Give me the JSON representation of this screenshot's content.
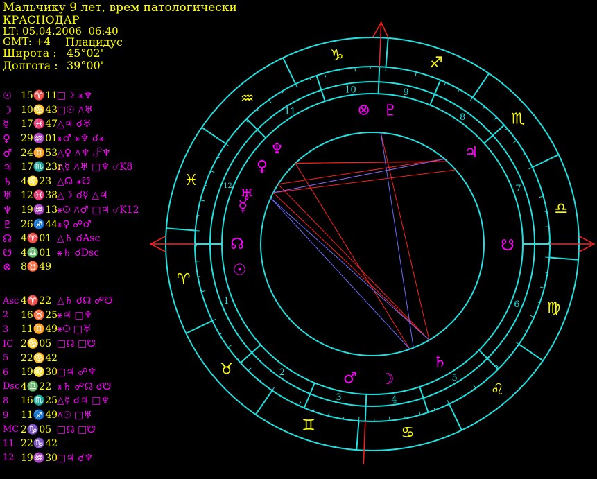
{
  "header": {
    "title": "Мальчику 9 лет, врем патологически",
    "city": "КРАСНОДАР",
    "lt": "LT: 05.04.2006  06:40",
    "gmt": "GMT: +4",
    "system": "Плацидус",
    "lat_label": "Широта :",
    "lat_value": "45°02'",
    "lon_label": "Долгота :",
    "lon_value": "39°00'"
  },
  "planets": [
    {
      "glyph": "☉",
      "pos": "15♈11",
      "aspects": "□☽ ⚹♆"
    },
    {
      "glyph": "☽",
      "pos": "10♋43",
      "aspects": "□☉ ⚻♅"
    },
    {
      "glyph": "☿",
      "pos": "17♓47",
      "aspects": "△♃ ☌♅"
    },
    {
      "glyph": "♀",
      "pos": "29♒01",
      "aspects": "⚹♂ ⚹♆ ☌⚹"
    },
    {
      "glyph": "♂",
      "pos": "24♊53",
      "aspects": "△♀ ⚻♆ ☍♆"
    },
    {
      "glyph": "♃",
      "pos": "17♏23r",
      "aspects": "△☿ ⚻♅ □♆ ☌K8"
    },
    {
      "glyph": "♄",
      "pos": "4♌23",
      "aspects": "△☊ ⚹☋"
    },
    {
      "glyph": "♅",
      "pos": "12♓38",
      "aspects": "△☽ ☌☿ △♃"
    },
    {
      "glyph": "♆",
      "pos": "19♒13",
      "aspects": "⚹☉ ⚻♂ □♃ ☌K12"
    },
    {
      "glyph": "♇",
      "pos": "26♐44",
      "aspects": "⚹♀ ☍♂"
    },
    {
      "glyph": "☊",
      "pos": "4♈01",
      "aspects": "△♄ ☌Asc"
    },
    {
      "glyph": "☋",
      "pos": "4♎01",
      "aspects": "⚹♄ ☌Dsc"
    },
    {
      "glyph": "⊗",
      "pos": "8♉49",
      "aspects": ""
    }
  ],
  "cusps": [
    {
      "label": "Asc",
      "pos": "4♈22",
      "aspects": "△♄ ☌☊ ☍☋"
    },
    {
      "label": "2",
      "pos": "16♉25",
      "aspects": "⚹♃ □♆"
    },
    {
      "label": "3",
      "pos": "11♊49",
      "aspects": "⚹☉ □♅"
    },
    {
      "label": "IC",
      "pos": "2♋05",
      "aspects": "□☊ □☋"
    },
    {
      "label": "5",
      "pos": "22♋42",
      "aspects": ""
    },
    {
      "label": "6",
      "pos": "19♌30",
      "aspects": "□♃ ☍♆"
    },
    {
      "label": "Dsc",
      "pos": "4♎22",
      "aspects": "⚹♄ ☍☊ ☌☋"
    },
    {
      "label": "8",
      "pos": "16♏25",
      "aspects": "△☿ ☌♃ □♆"
    },
    {
      "label": "9",
      "pos": "11♐49",
      "aspects": "⚻☉ □♅"
    },
    {
      "label": "MC",
      "pos": "2♑05",
      "aspects": "□☊ □☋"
    },
    {
      "label": "11",
      "pos": "22♑42",
      "aspects": ""
    },
    {
      "label": "12",
      "pos": "19♒30",
      "aspects": "□♃ ☌♆"
    }
  ],
  "wheel": {
    "signs": [
      {
        "glyph": "♈",
        "deg": 15
      },
      {
        "glyph": "♉",
        "deg": 45
      },
      {
        "glyph": "♊",
        "deg": 75
      },
      {
        "glyph": "♋",
        "deg": 105
      },
      {
        "glyph": "♌",
        "deg": 135
      },
      {
        "glyph": "♍",
        "deg": 165
      },
      {
        "glyph": "♎",
        "deg": 195
      },
      {
        "glyph": "♏",
        "deg": 225
      },
      {
        "glyph": "♐",
        "deg": 255
      },
      {
        "glyph": "♑",
        "deg": 285
      },
      {
        "glyph": "♒",
        "deg": 315
      },
      {
        "glyph": "♓",
        "deg": 345
      }
    ],
    "houses": [
      {
        "num": "1",
        "cusp": 4.37,
        "next": 46.42
      },
      {
        "num": "2",
        "cusp": 46.42,
        "next": 71.82
      },
      {
        "num": "3",
        "cusp": 71.82,
        "next": 92.08
      },
      {
        "num": "4",
        "cusp": 92.08,
        "next": 112.7
      },
      {
        "num": "5",
        "cusp": 112.7,
        "next": 139.5
      },
      {
        "num": "6",
        "cusp": 139.5,
        "next": 184.37
      },
      {
        "num": "7",
        "cusp": 184.37,
        "next": 226.42
      },
      {
        "num": "8",
        "cusp": 226.42,
        "next": 251.82
      },
      {
        "num": "9",
        "cusp": 251.82,
        "next": 272.08
      },
      {
        "num": "10",
        "cusp": 272.08,
        "next": 292.7
      },
      {
        "num": "11",
        "cusp": 292.7,
        "next": 319.5
      },
      {
        "num": "12",
        "cusp": 319.5,
        "next": 364.37
      }
    ],
    "bodies": [
      {
        "glyph": "☉",
        "deg": 15.18,
        "color": "#ff00ff"
      },
      {
        "glyph": "☽",
        "deg": 100.72,
        "color": "#ff00ff"
      },
      {
        "glyph": "☿",
        "deg": 347.78,
        "color": "#ff00ff"
      },
      {
        "glyph": "♀",
        "deg": 329.02,
        "color": "#ff00ff"
      },
      {
        "glyph": "♂",
        "deg": 84.88,
        "color": "#ff00ff"
      },
      {
        "glyph": "♃",
        "deg": 227.38,
        "color": "#ff00ff"
      },
      {
        "glyph": "♄",
        "deg": 124.38,
        "color": "#ff00ff"
      },
      {
        "glyph": "♅",
        "deg": 342.63,
        "color": "#ff00ff"
      },
      {
        "glyph": "♆",
        "deg": 319.22,
        "color": "#ff00ff"
      },
      {
        "glyph": "♇",
        "deg": 266.73,
        "color": "#ff00ff"
      },
      {
        "glyph": "☊",
        "deg": 4.02,
        "color": "#ff00ff"
      },
      {
        "glyph": "☋",
        "deg": 184.02,
        "color": "#ff00ff"
      },
      {
        "glyph": "⊗",
        "deg": 278.0,
        "color": "#ff00ff"
      }
    ],
    "aspect_lines": [
      {
        "a": 337,
        "b": 226,
        "color": "#ff2020"
      },
      {
        "a": 337,
        "b": 234,
        "color": "#ff2020"
      },
      {
        "a": 337,
        "b": 125,
        "color": "#ff2020"
      },
      {
        "a": 318,
        "b": 232,
        "color": "#ff2020"
      },
      {
        "a": 332,
        "b": 234,
        "color": "#ff2020"
      },
      {
        "a": 332,
        "b": 125,
        "color": "#ff2020"
      },
      {
        "a": 270,
        "b": 125,
        "color": "#ff2020"
      },
      {
        "a": 318,
        "b": 114,
        "color": "#ff2020"
      },
      {
        "a": 318,
        "b": 232,
        "color": "#ff2020"
      },
      {
        "a": 337,
        "b": 234,
        "color": "#6a6aff"
      },
      {
        "a": 270,
        "b": 116,
        "color": "#6a6aff"
      },
      {
        "a": 340,
        "b": 125,
        "color": "#6a6aff"
      },
      {
        "a": 340,
        "b": 114,
        "color": "#6a6aff"
      }
    ],
    "colors": {
      "ring": "#20e0e0",
      "axis": "#ff2020",
      "sign": "#ffff00",
      "house_num": "#20e0e0"
    }
  }
}
